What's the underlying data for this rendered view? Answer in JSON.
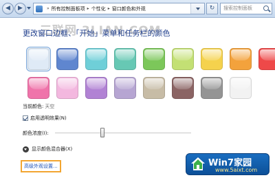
{
  "toolbar": {
    "back_label": "◀",
    "forward_label": "▶",
    "refresh_label": "↻",
    "breadcrumbs": [
      "所有控制面板项",
      "个性化",
      "窗口颜色和外观"
    ],
    "search_placeholder": "搜索控制面板"
  },
  "page": {
    "title": "更改窗口边框、「开始」菜单和任务栏的颜色",
    "watermark": "三联网 3LIAN.COM"
  },
  "swatches": {
    "row1": [
      "#dfeaf6",
      "#5f86cf",
      "#6fcfd8",
      "#67c8b4",
      "#7cc75a",
      "#c3e074",
      "#f5d24d",
      "#f3a23c",
      "#ee4949"
    ],
    "row2": [
      "#ef74aa",
      "#f3b8df",
      "#b182d4",
      "#b6a5d2",
      "#c7bca6",
      "#8b6464",
      "#949494",
      "#f2f2f2"
    ],
    "selected_index": 0
  },
  "current_color": {
    "label": "当前颜色:",
    "value": "天空"
  },
  "transparency": {
    "label": "启用透明效果(N)",
    "checked": true
  },
  "intensity": {
    "label": "颜色浓度(I):",
    "level_percent": 35
  },
  "mixer": {
    "label": "显示颜色混合器(X)"
  },
  "advanced_link": "高级外观设置...",
  "logo": {
    "title": "Win7家园",
    "url": "www.5aixt.com"
  }
}
